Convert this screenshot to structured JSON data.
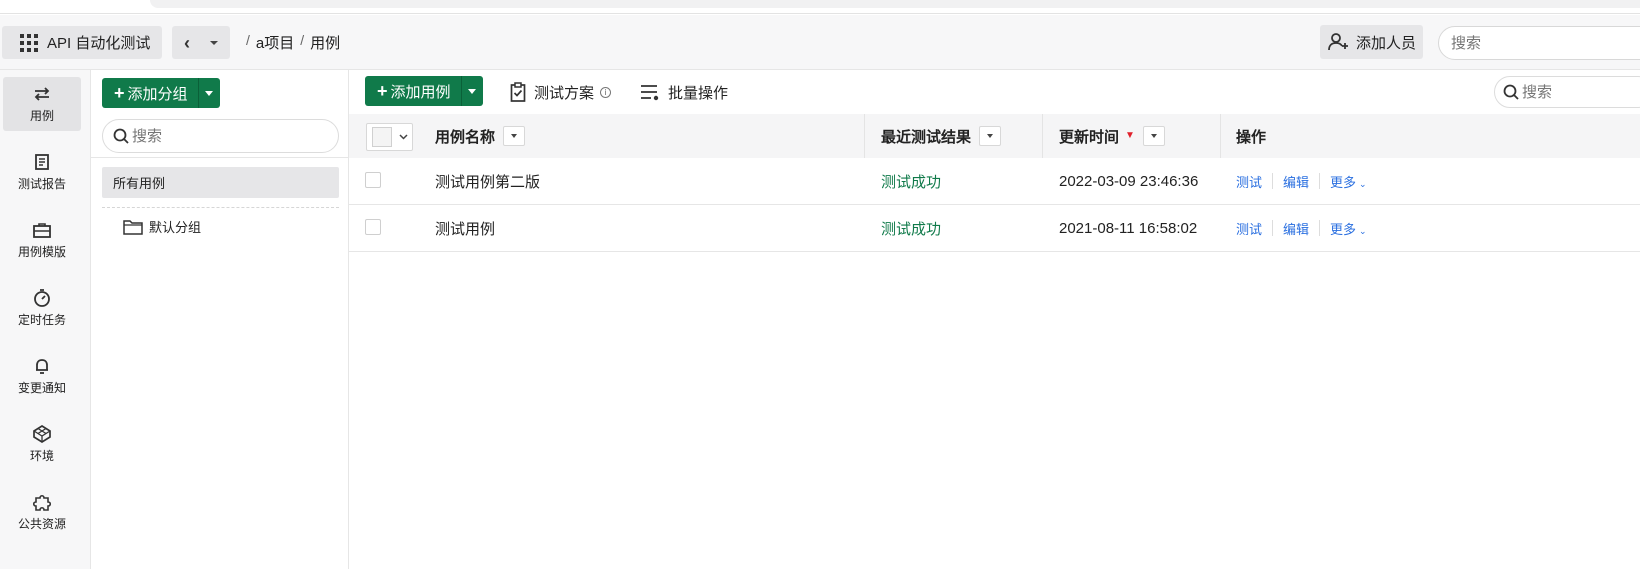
{
  "header": {
    "app_name": "API 自动化测试",
    "breadcrumbs": [
      "a项目",
      "用例"
    ],
    "add_member_label": "添加人员",
    "search_placeholder": "搜索"
  },
  "rail": {
    "items": [
      {
        "label": "用例",
        "icon": "swap-arrows-icon",
        "active": true
      },
      {
        "label": "测试报告",
        "icon": "report-icon"
      },
      {
        "label": "用例模版",
        "icon": "briefcase-icon"
      },
      {
        "label": "定时任务",
        "icon": "stopwatch-icon"
      },
      {
        "label": "变更通知",
        "icon": "bell-icon"
      },
      {
        "label": "环境",
        "icon": "cube-icon"
      },
      {
        "label": "公共资源",
        "icon": "puzzle-icon"
      }
    ]
  },
  "groups": {
    "add_group_label": "添加分组",
    "search_placeholder": "搜索",
    "all_cases_label": "所有用例",
    "default_group_label": "默认分组"
  },
  "toolbar": {
    "add_case_label": "添加用例",
    "test_plan_label": "测试方案",
    "batch_label": "批量操作",
    "search_placeholder": "搜索"
  },
  "table": {
    "columns": {
      "name": "用例名称",
      "result": "最近测试结果",
      "updated": "更新时间",
      "actions": "操作"
    },
    "rows": [
      {
        "name": "测试用例第二版",
        "result": "测试成功",
        "updated": "2022-03-09 23:46:36"
      },
      {
        "name": "测试用例",
        "result": "测试成功",
        "updated": "2021-08-11 16:58:02"
      }
    ],
    "action_labels": {
      "test": "测试",
      "edit": "编辑",
      "more": "更多"
    }
  },
  "colors": {
    "primary_green": "#107a4a",
    "link_blue": "#2a6fe0",
    "sort_red": "#e0202a"
  }
}
